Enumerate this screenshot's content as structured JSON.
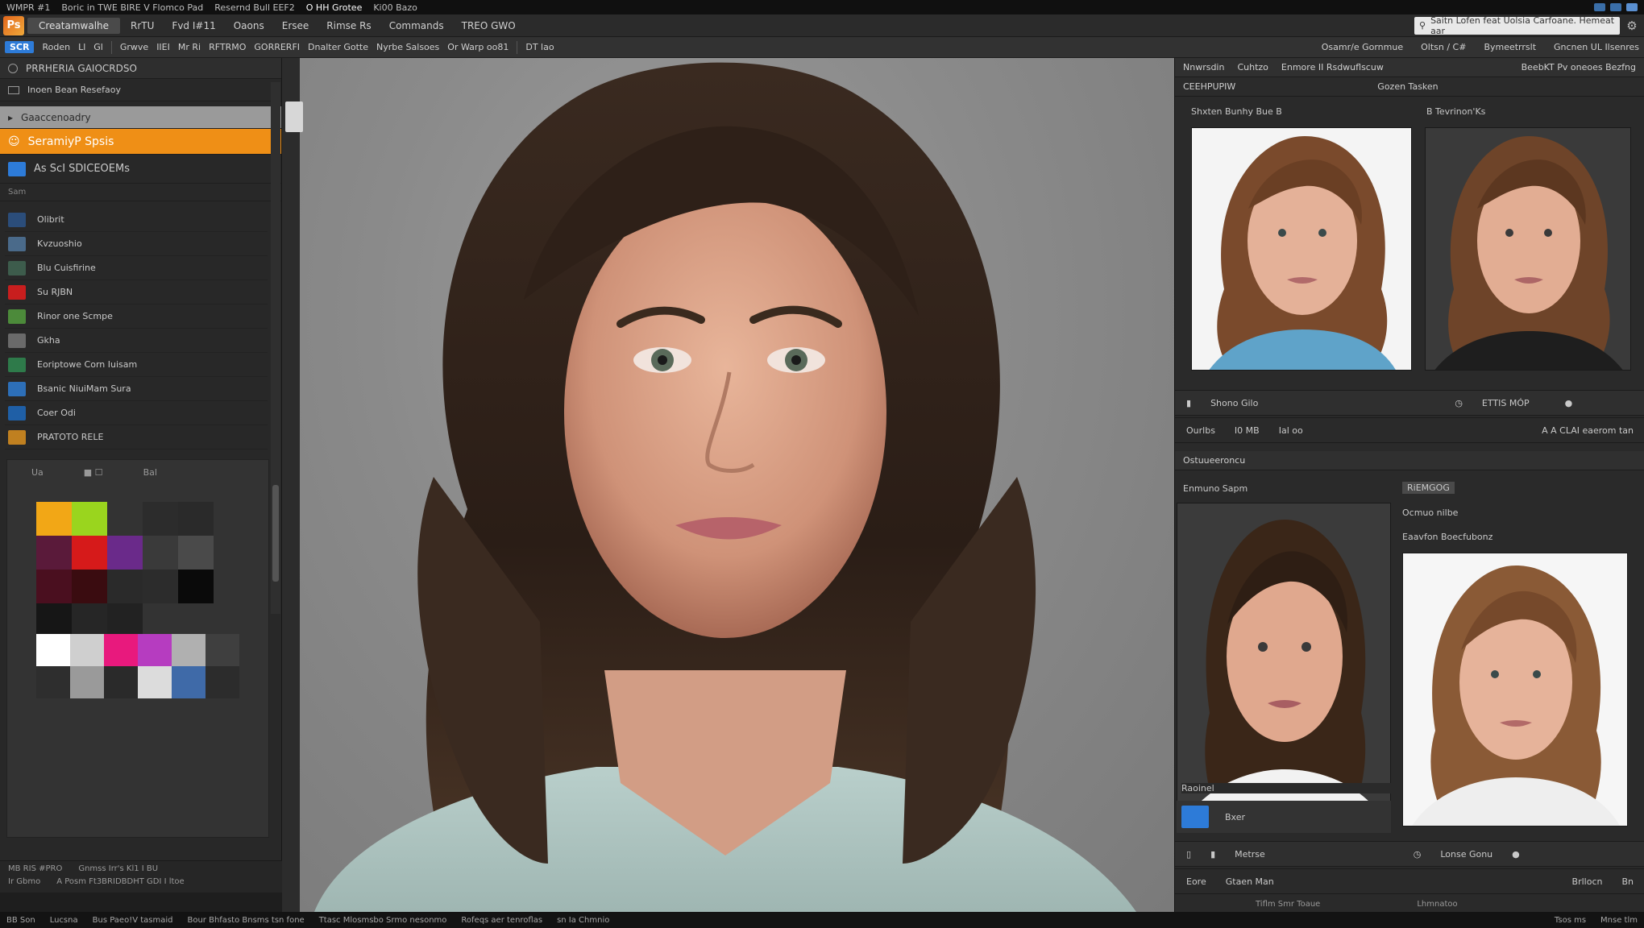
{
  "titlebar": {
    "items": [
      "WMPR #1",
      "Boric in TWE BIRE V Flomco Pad",
      "Resernd Bull EEF2",
      "O HH Grotee",
      "Ki00 Bazo"
    ]
  },
  "menubar": {
    "active_tab": "Creatamwalhe",
    "items": [
      "RrTU",
      "Fvd I#11",
      "Oaons",
      "Ersee",
      "Rimse Rs",
      "Commands",
      "TREO GWO"
    ],
    "search_placeholder": "Saitn Lofen feat Uolsia Carfoane.  Hemeat aar"
  },
  "optbar": {
    "badge": "SCR",
    "items": [
      "Roden",
      "Ll",
      "Gl",
      "Grwve",
      "IIEI",
      "Mr Ri",
      "RFTRMO",
      "GORRERFI",
      "Dnalter Gotte",
      "Nyrbe Salsoes",
      "Or Warp oo81"
    ],
    "mid": "DT  lao",
    "right": [
      "Osamr/e Gornmue",
      "Oltsn / C#",
      "Bymeetrrslt",
      "Gncnen UL Ilsenres"
    ]
  },
  "left_panel": {
    "head_label": "PRRHERIA GAIOCRDSO",
    "row2": "Inoen Bean Resefaoy",
    "light_row": "Gaaccenoadry",
    "orange_row": "SeramiyP Spsis",
    "blue_row": "As  ScI SDICEOEMs",
    "small_row": "Sam",
    "items": [
      {
        "label": "Olibrit",
        "icon_color": "#2b4d7a"
      },
      {
        "label": "Kvzuoshio",
        "icon_color": "#4a6a8a"
      },
      {
        "label": "Blu Cuisfirine",
        "icon_color": "#3d5c4c"
      },
      {
        "label": "Su RJBN",
        "icon_color": "#c81e1e"
      },
      {
        "label": "Rinor one Scmpe",
        "icon_color": "#4c8a3a"
      },
      {
        "label": "Gkha",
        "icon_color": "#6a6a6a"
      },
      {
        "label": "Eoriptowe Corn Iuisam",
        "icon_color": "#2e7a4a"
      },
      {
        "label": "Bsanic NiuiMam Sura",
        "icon_color": "#2d6fb8"
      },
      {
        "label": "Coer Odi",
        "icon_color": "#1f5fa6"
      },
      {
        "label": "PRATOTO RELE",
        "icon_color": "#c08020"
      }
    ],
    "swatch_header": [
      "Ua",
      "■ ☐",
      "Bal"
    ],
    "swatch_colors": [
      "#f2a716",
      "#9ad51e",
      "#333333",
      "#2c2c2c",
      "#2a2a2a",
      "#5a1a3a",
      "#d61a1a",
      "#6a2a8a",
      "#3a3a3a",
      "#4a4a4a",
      "#4a0f1f",
      "#3a0c10",
      "#2a2a2a",
      "#2c2c2c",
      "#0a0a0a",
      "#161616",
      "#262626",
      "#222222"
    ],
    "swatch_colors2": [
      "#ffffff",
      "#cfcfcf",
      "#e8197d",
      "#b63cc0",
      "#b0b0b0",
      "#3f3f3f",
      "#2e2e2e",
      "#9a9a9a",
      "#2a2a2a",
      "#dcdcdc",
      "#3f6aa8",
      "#2c2c2c"
    ],
    "footer_line1": [
      "MB RIS #PRO",
      "Gnmss Irr's Kl1 I BU"
    ],
    "footer_line2": [
      "Ir Gbmo",
      "A Posm Ft3BRIDBDHT GDI I ltoe"
    ]
  },
  "right_panel": {
    "bar1": [
      "Nnwrsdin",
      "Cuhtzo",
      "Enmore II Rsdwuflscuw",
      "BeebKT Pv oneoes Bezfng"
    ],
    "bar2": [
      "CEEHPUPIW",
      "Gozen Tasken"
    ],
    "label_a": "Shxten Bunhy Bue B",
    "label_b": "B Tevrinon'Ks",
    "ctrl1": [
      "Shono Gilo",
      "ETTIS MÓP"
    ],
    "ctrl2": [
      "Ourlbs",
      "I0 MB",
      "Ial oo",
      "A  A CLAI eaerom tan"
    ],
    "section": "Ostuueeroncu",
    "sub_label_a": "Enmuno Sapm",
    "sub_badge": "RiEMGOG",
    "sub_label_b": "Ocmuo nilbe",
    "sub_label_c": "Eaavfon Boecfubonz",
    "list_label": "Raoinel",
    "list_item": "Bxer",
    "ctrl3": [
      "Metrse",
      "Lonse Gonu"
    ],
    "ctrl4": [
      "Eore",
      "Gtaen Man",
      "Brllocn",
      "Bn"
    ],
    "footer": [
      "Tiflm  Smr  Toaue",
      "Lhmnatoo"
    ]
  },
  "statusbar": {
    "items": [
      "BB Son",
      "Lucsna",
      "Bus Paeo!V tasmaid",
      "Bour Bhfasto Bnsms tsn fone",
      "Ttasc Mlosmsbo  Srmo nesonmo",
      "Rofeqs aer tenroflas",
      "sn Ia Chmnio",
      "Tsos ms",
      "Mnse tlm"
    ]
  }
}
